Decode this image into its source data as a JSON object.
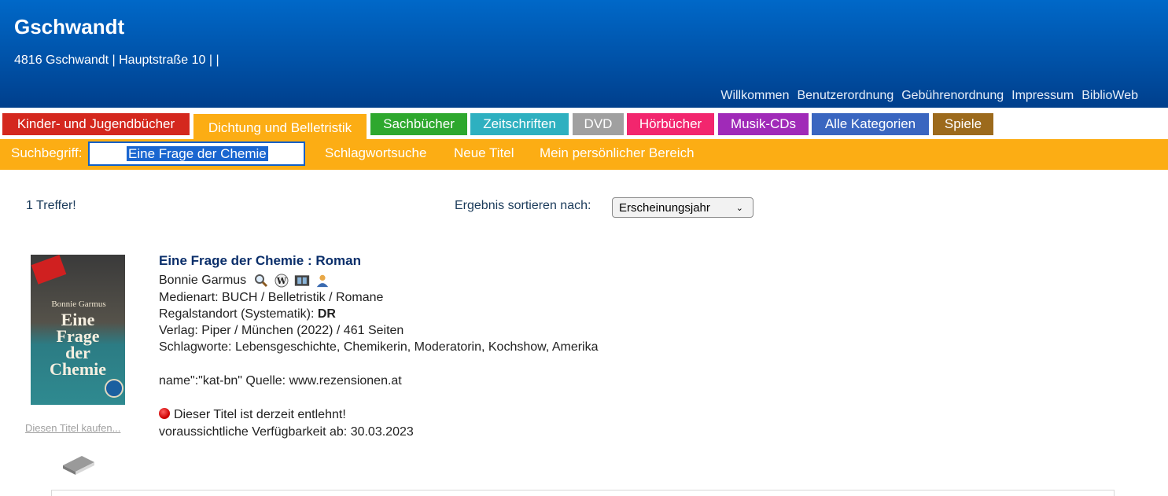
{
  "header": {
    "title": "Gschwandt",
    "address": "4816 Gschwandt | Hauptstraße 10 | |",
    "links": [
      "Willkommen",
      "Benutzerordnung",
      "Gebührenordnung",
      "Impressum",
      "BiblioWeb"
    ]
  },
  "categories": [
    {
      "label": "Kinder- und Jugendbücher",
      "color": "#d4281e"
    },
    {
      "label": "Dichtung und Belletristik",
      "color": "#fcad14",
      "active": true
    },
    {
      "label": "Sachbücher",
      "color": "#2ea82e"
    },
    {
      "label": "Zeitschriften",
      "color": "#2eb0c0"
    },
    {
      "label": "DVD",
      "color": "#a0a0a0"
    },
    {
      "label": "Hörbücher",
      "color": "#f2266e"
    },
    {
      "label": "Musik-CDs",
      "color": "#a02ab8"
    },
    {
      "label": "Alle Kategorien",
      "color": "#3a66c0"
    },
    {
      "label": "Spiele",
      "color": "#9c6a1c"
    }
  ],
  "search": {
    "label": "Suchbegriff:",
    "value": "Eine Frage der Chemie",
    "links": [
      "Schlagwortsuche",
      "Neue Titel",
      "Mein persönlicher Bereich"
    ]
  },
  "results": {
    "count_text": "1 Treffer!",
    "sort_label": "Ergebnis sortieren nach:",
    "sort_value": "Erscheinungsjahr"
  },
  "item": {
    "cover": {
      "author": "Bonnie Garmus",
      "title_lines": [
        "Eine",
        "Frage",
        "der",
        "Chemie"
      ]
    },
    "buy_link": "Diesen Titel kaufen...",
    "title": "Eine Frage der Chemie : Roman",
    "author": "Bonnie Garmus",
    "media": "Medienart: BUCH / Belletristik / Romane",
    "shelf_label": "Regalstandort (Systematik): ",
    "shelf_value": "DR",
    "publisher": "Verlag: Piper / München (2022) / 461 Seiten",
    "keywords": "Schlagworte: Lebensgeschichte, Chemikerin, Moderatorin, Kochshow, Amerika",
    "source": "name\":\"kat-bn\" Quelle: www.rezensionen.at",
    "status": "Dieser Titel ist derzeit entlehnt!",
    "availability": "voraussichtliche Verfügbarkeit ab: 30.03.2023"
  },
  "colors": {
    "header_blue": "#0057b0",
    "search_bar": "#fcad14",
    "title_link": "#0a2e6a"
  }
}
